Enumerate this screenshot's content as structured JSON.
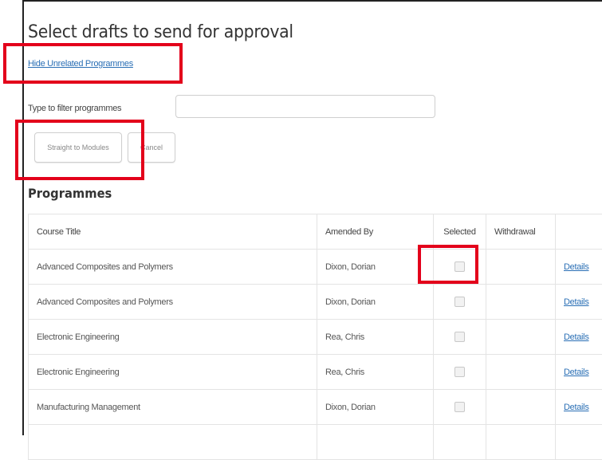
{
  "page": {
    "title": "Select drafts to send for approval",
    "hide_link": "Hide Unrelated Programmes"
  },
  "filter": {
    "label": "Type to filter programmes",
    "value": "",
    "placeholder": ""
  },
  "buttons": {
    "straight_to_modules": "Straight to Modules",
    "cancel": "Cancel"
  },
  "programmes": {
    "heading": "Programmes",
    "columns": [
      "Course Title",
      "Amended By",
      "Selected",
      "Withdrawal",
      ""
    ],
    "rows": [
      {
        "course_title": "Advanced Composites and Polymers",
        "amended_by": "Dixon, Dorian",
        "selected": false,
        "withdrawal": "",
        "action": "Details"
      },
      {
        "course_title": "Advanced Composites and Polymers",
        "amended_by": "Dixon, Dorian",
        "selected": false,
        "withdrawal": "",
        "action": "Details"
      },
      {
        "course_title": "Electronic Engineering",
        "amended_by": "Rea, Chris",
        "selected": false,
        "withdrawal": "",
        "action": "Details"
      },
      {
        "course_title": "Electronic Engineering",
        "amended_by": "Rea, Chris",
        "selected": false,
        "withdrawal": "",
        "action": "Details"
      },
      {
        "course_title": "Manufacturing Management",
        "amended_by": "Dixon, Dorian",
        "selected": false,
        "withdrawal": "",
        "action": "Details"
      },
      {
        "course_title": "",
        "amended_by": "",
        "selected": null,
        "withdrawal": "",
        "action": ""
      }
    ]
  },
  "colors": {
    "link": "#2a6fb5",
    "annotation": "#e3001b",
    "text": "#333333"
  }
}
